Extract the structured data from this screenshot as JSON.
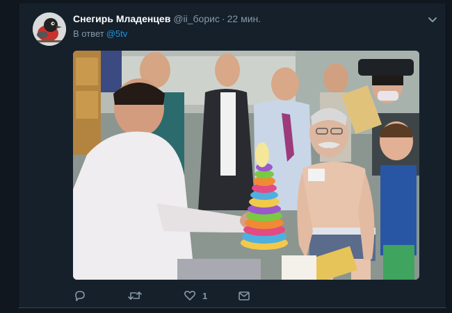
{
  "tweet": {
    "author_name": "Снегирь Младенцев",
    "author_handle": "@ii_борис",
    "separator": "·",
    "time": "22 мин.",
    "reply_prefix": "В ответ",
    "reply_to": "@5tv",
    "like_count": "1",
    "icons": {
      "more": "chevron-down-icon",
      "reply": "reply-icon",
      "retweet": "retweet-icon",
      "like": "heart-icon",
      "dm": "envelope-icon"
    }
  },
  "colors": {
    "page_bg": "#10171e",
    "card_bg": "#15202b",
    "name": "#ffffff",
    "secondary": "#8899a6",
    "accent": "#1b95e0",
    "border": "#38444d"
  }
}
